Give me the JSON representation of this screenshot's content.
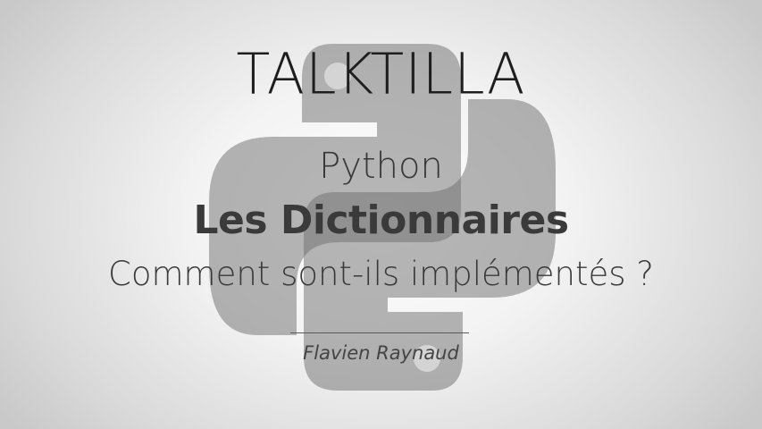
{
  "slide": {
    "brand": "TALKTILLA",
    "language": "Python",
    "headline": "Les Dictionnaires",
    "question": "Comment sont-ils implémentés ?",
    "author": "Flavien Raynaud"
  },
  "logo": {
    "icon": "python-logo-icon",
    "color": "#6e6e6e"
  },
  "colors": {
    "text": "#2b2b2b",
    "background_center": "#ffffff",
    "background_edge": "#c9c9c9"
  }
}
